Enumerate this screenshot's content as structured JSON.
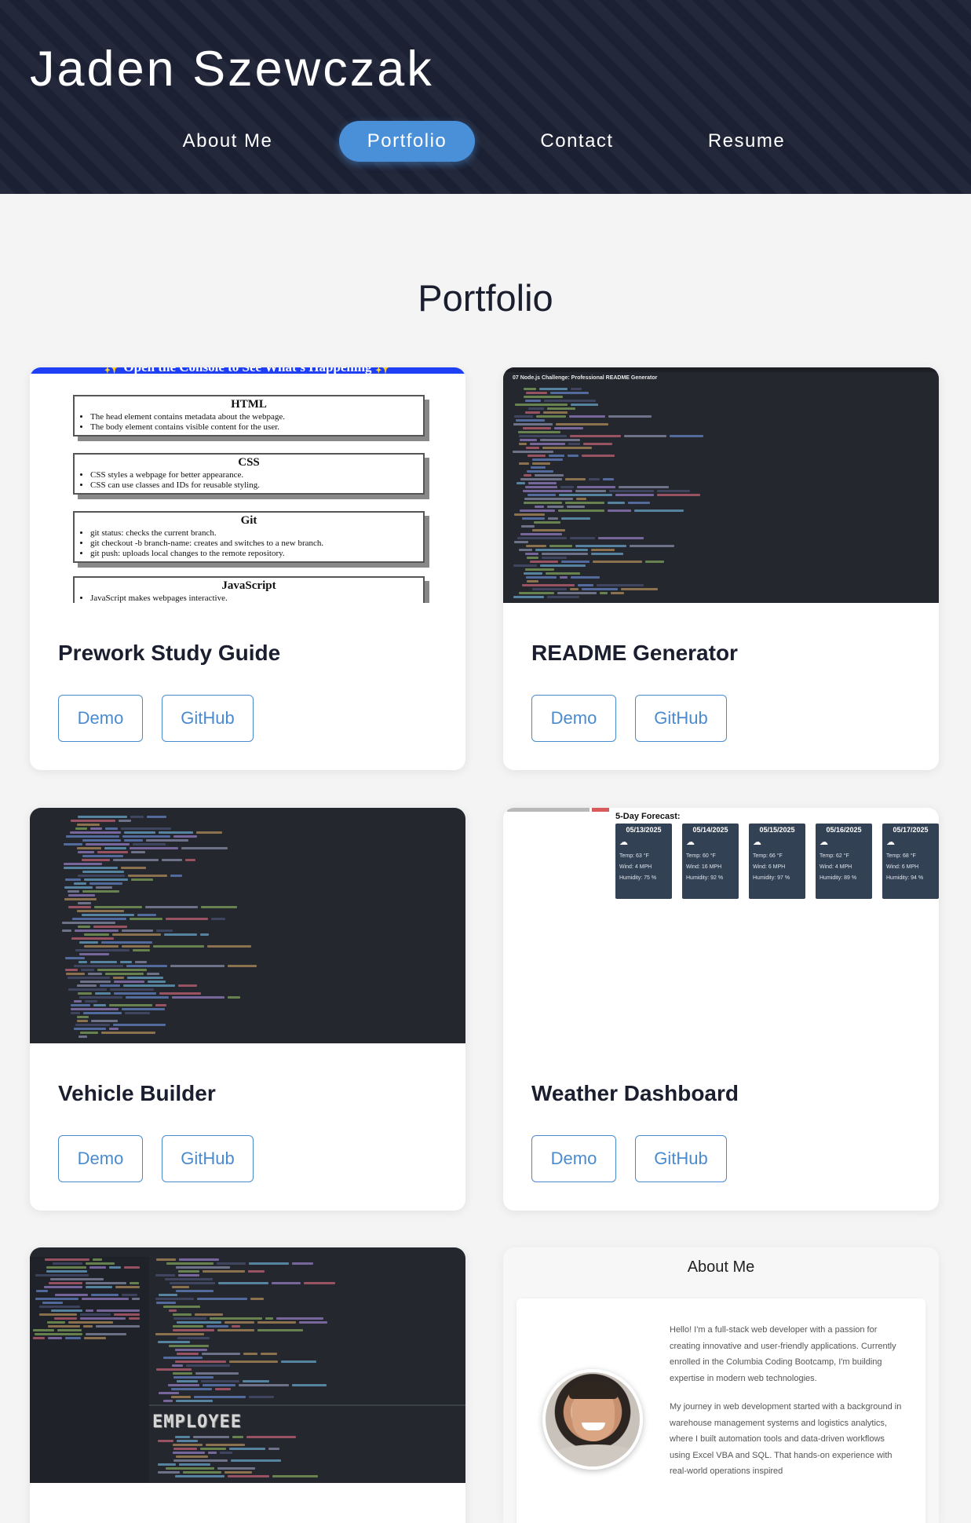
{
  "header": {
    "site_title": "Jaden Szewczak",
    "nav": [
      {
        "label": "About Me",
        "active": false
      },
      {
        "label": "Portfolio",
        "active": true
      },
      {
        "label": "Contact",
        "active": false
      },
      {
        "label": "Resume",
        "active": false
      }
    ]
  },
  "portfolio": {
    "section_title": "Portfolio",
    "projects": [
      {
        "title": "Prework Study Guide",
        "demo_label": "Demo",
        "github_label": "GitHub"
      },
      {
        "title": "README Generator",
        "demo_label": "Demo",
        "github_label": "GitHub"
      },
      {
        "title": "Vehicle Builder",
        "demo_label": "Demo",
        "github_label": "GitHub"
      },
      {
        "title": "Weather Dashboard",
        "demo_label": "Demo",
        "github_label": "GitHub"
      }
    ]
  },
  "study_guide_thumb": {
    "banner": "✨ Open the Console to See What's Happening ✨",
    "boxes": [
      {
        "heading": "HTML",
        "items": [
          "The head element contains metadata about the webpage.",
          "The body element contains visible content for the user."
        ]
      },
      {
        "heading": "CSS",
        "items": [
          "CSS styles a webpage for better appearance.",
          "CSS can use classes and IDs for reusable styling."
        ]
      },
      {
        "heading": "Git",
        "items": [
          "git status: checks the current branch.",
          "git checkout -b branch-name: creates and switches to a new branch.",
          "git push: uploads local changes to the remote repository."
        ]
      },
      {
        "heading": "JavaScript",
        "items": [
          "JavaScript makes webpages interactive."
        ]
      }
    ]
  },
  "readme_thumb": {
    "heading": "07 Node.js Challenge: Professional README Generator"
  },
  "employee_thumb": {
    "ascii_title": "EMPLOYEE"
  },
  "weather_thumb": {
    "heading": "5-Day Forecast:",
    "days": [
      {
        "date": "05/13/2025",
        "temp": "Temp: 63 °F",
        "wind": "Wind: 4 MPH",
        "humidity": "Humidity: 75 %"
      },
      {
        "date": "05/14/2025",
        "temp": "Temp: 60 °F",
        "wind": "Wind: 16 MPH",
        "humidity": "Humidity: 92 %"
      },
      {
        "date": "05/15/2025",
        "temp": "Temp: 66 °F",
        "wind": "Wind: 6 MPH",
        "humidity": "Humidity: 97 %"
      },
      {
        "date": "05/16/2025",
        "temp": "Temp: 62 °F",
        "wind": "Wind: 4 MPH",
        "humidity": "Humidity: 89 %"
      },
      {
        "date": "05/17/2025",
        "temp": "Temp: 68 °F",
        "wind": "Wind: 6 MPH",
        "humidity": "Humidity: 94 %"
      }
    ]
  },
  "about_preview": {
    "heading": "About Me",
    "paragraph_1": "Hello! I'm a full-stack web developer with a passion for creating innovative and user-friendly applications. Currently enrolled in the Columbia Coding Bootcamp, I'm building expertise in modern web technologies.",
    "paragraph_2": "My journey in web development started with a background in warehouse management systems and logistics analytics, where I built automation tools and data-driven workflows using Excel VBA and SQL. That hands-on experience with real-world operations inspired"
  },
  "colors": {
    "header_bg": "#1b2033",
    "accent": "#4a90d9",
    "button_border": "#4a8bd0",
    "page_bg": "#f4f4f4"
  }
}
